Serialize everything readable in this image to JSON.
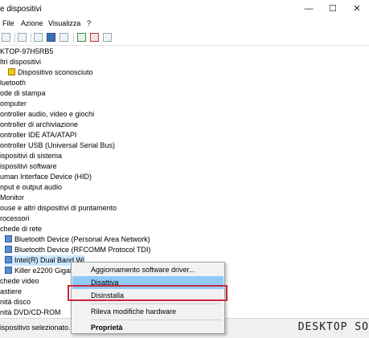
{
  "window": {
    "title": "e dispositivi",
    "controls": {
      "minimize": "—",
      "maximize": "☐",
      "close": "✕"
    }
  },
  "menu": {
    "items": [
      "File",
      "Azione",
      "Visualizza",
      "?"
    ]
  },
  "toolbar": {
    "icons": [
      "back-icon",
      "forward-icon",
      "properties-icon",
      "grid-icon",
      "help-icon",
      "monitor-icon",
      "update-driver-icon",
      "disable-device-icon",
      "uninstall-device-icon",
      "scan-hardware-icon"
    ]
  },
  "tree": {
    "items": [
      {
        "label": "KTOP-97H5RB5"
      },
      {
        "label": "ltri dispositivi"
      },
      {
        "label": "Dispositivo sconosciuto",
        "icon": "warning-icon"
      },
      {
        "label": "luetooth"
      },
      {
        "label": "ode di stampa"
      },
      {
        "label": "omputer"
      },
      {
        "label": "ontroller audio, video e giochi"
      },
      {
        "label": "ontroller di archiviazione"
      },
      {
        "label": "ontroller IDE ATA/ATAPI"
      },
      {
        "label": "ontroller USB (Universal Serial Bus)"
      },
      {
        "label": "ispositivi di sistema"
      },
      {
        "label": "ispositivi software"
      },
      {
        "label": "uman Interface Device (HID)"
      },
      {
        "label": "nput e output audio"
      },
      {
        "label": "Monitor"
      },
      {
        "label": "ouse e altri dispositivi di puntamento"
      },
      {
        "label": "rocessori"
      },
      {
        "label": "chede di rete"
      },
      {
        "label": "Bluetooth Device (Personal Area Network)",
        "icon": "network-adapter-icon"
      },
      {
        "label": "Bluetooth Device (RFCOMM Protocol TDI)",
        "icon": "network-adapter-icon"
      },
      {
        "label": "Intel(R) Dual Band Wi",
        "icon": "network-adapter-icon",
        "selected": true
      },
      {
        "label": "Killer e2200 Gigabit Et",
        "icon": "network-adapter-icon"
      },
      {
        "label": "chede video"
      },
      {
        "label": "astiere"
      },
      {
        "label": "nità disco"
      },
      {
        "label": "nità DVD/CD-ROM"
      }
    ]
  },
  "context_menu": {
    "items": [
      {
        "label": "Aggiornamento software driver..."
      },
      {
        "label": "Disattiva"
      },
      {
        "label": "Disinstalla"
      },
      {
        "label": "Rileva modifiche hardware"
      },
      {
        "label": "Proprietà"
      }
    ]
  },
  "status": {
    "text": "ispositivo selezionato."
  },
  "watermark": {
    "text": "DESKTOP SO"
  }
}
